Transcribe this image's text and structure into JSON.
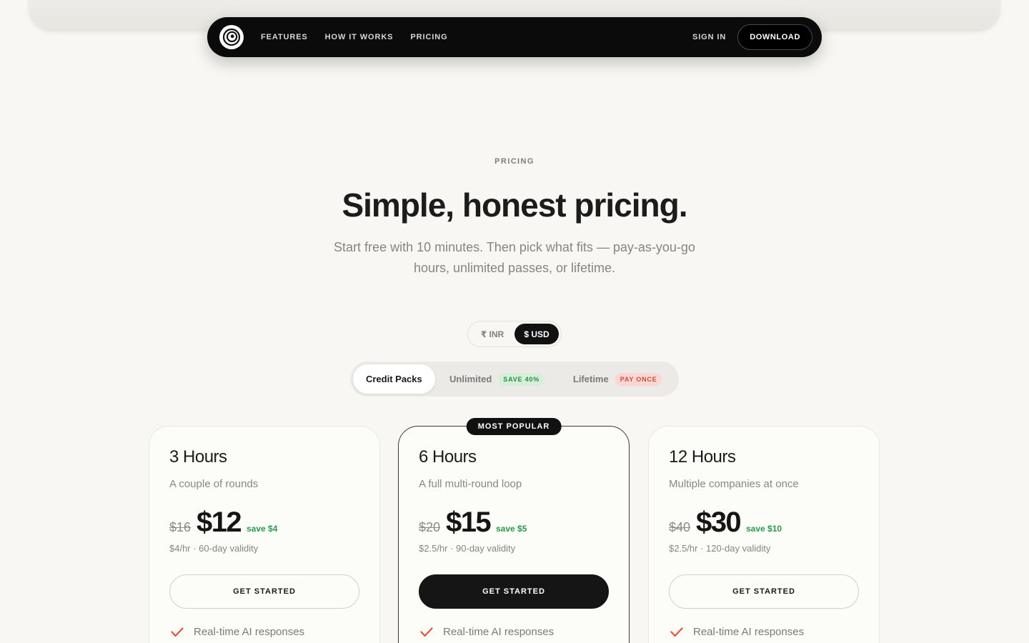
{
  "nav": {
    "links": [
      "FEATURES",
      "HOW IT WORKS",
      "PRICING"
    ],
    "signin_label": "SIGN IN",
    "download_label": "DOWNLOAD"
  },
  "hero": {
    "eyebrow": "PRICING",
    "title": "Simple, honest pricing.",
    "subtitle": "Start free with 10 minutes. Then pick what fits — pay-as-you-go hours, unlimited passes, or lifetime."
  },
  "currency": {
    "options": [
      "₹ INR",
      "$ USD"
    ],
    "selected": "$ USD"
  },
  "plan_tabs": [
    {
      "label": "Credit Packs",
      "badge": "",
      "active": true
    },
    {
      "label": "Unlimited",
      "badge": "SAVE 40%",
      "active": false
    },
    {
      "label": "Lifetime",
      "badge": "PAY ONCE",
      "active": false
    }
  ],
  "cards": [
    {
      "title": "3 Hours",
      "description": "A couple of rounds",
      "old_price": "$16",
      "price": "$12",
      "save": "save $4",
      "rate": "$4/hr · 60-day validity",
      "cta": "GET STARTED",
      "feature": "Real-time AI responses"
    },
    {
      "badge": "MOST POPULAR",
      "title": "6 Hours",
      "description": "A full multi-round loop",
      "old_price": "$20",
      "price": "$15",
      "save": "save $5",
      "rate": "$2.5/hr · 90-day validity",
      "cta": "GET STARTED",
      "feature": "Real-time AI responses"
    },
    {
      "title": "12 Hours",
      "description": "Multiple companies at once",
      "old_price": "$40",
      "price": "$30",
      "save": "save $10",
      "rate": "$2.5/hr · 120-day validity",
      "cta": "GET STARTED",
      "feature": "Real-time AI responses"
    }
  ],
  "colors": {
    "accent_check": "#e0533d",
    "save_green": "#2a9a4a",
    "dark": "#111111",
    "background": "#f8f7f3"
  },
  "icons": {
    "logo": "spiral-logo-icon",
    "feature": "check-icon"
  }
}
